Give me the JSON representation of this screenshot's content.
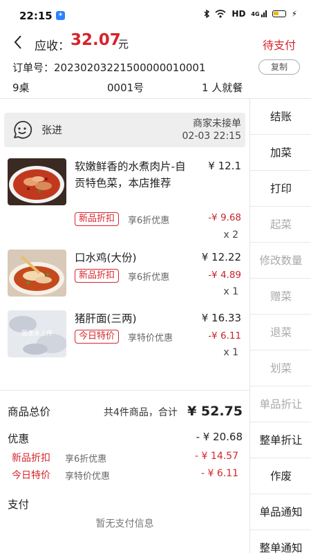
{
  "status_bar": {
    "time": "22:15",
    "app_badge": "✶",
    "network": "HD",
    "signal": "4G"
  },
  "header": {
    "amount_label": "应收：",
    "amount_value": "32.07",
    "amount_unit": "元",
    "status": "待支付",
    "order_no": "订单号：20230203221500000010001",
    "copy_label": "复制",
    "table": "9桌",
    "serial": "0001号",
    "diners": "1 人就餐"
  },
  "customer": {
    "name": "张进",
    "status": "商家未接单",
    "time": "02-03 22:15"
  },
  "dishes": [
    {
      "name": "软嫩鲜香的水煮肉片-自贡特色菜，本店推荐",
      "price": "¥ 12.1",
      "tag": "新品折扣",
      "tag_desc": "享6折优惠",
      "discount": "-¥ 9.68",
      "qty": "x 2",
      "image": "boiled-pork-slices"
    },
    {
      "name": "口水鸡(大份)",
      "price": "¥ 12.22",
      "tag": "新品折扣",
      "tag_desc": "享6折优惠",
      "discount": "-¥ 4.89",
      "qty": "x 1",
      "image": "mouthwatering-chicken"
    },
    {
      "name": "猪肝面(三两)",
      "price": "¥ 16.33",
      "tag": "今日特价",
      "tag_desc": "享特价优惠",
      "discount": "-¥ 6.11",
      "qty": "x 1",
      "image": "placeholder",
      "image_text": "图像未上传"
    }
  ],
  "summary": {
    "total_label": "商品总价",
    "count_text": "共4件商品，合计",
    "total": "¥ 52.75",
    "discount_label": "优惠",
    "discount_total": "- ¥ 20.68",
    "discounts": [
      {
        "name": "新品折扣",
        "desc": "享6折优惠",
        "amount": "- ¥ 14.57"
      },
      {
        "name": "今日特价",
        "desc": "享特价优惠",
        "amount": "- ¥ 6.11"
      }
    ],
    "payment_label": "支付",
    "no_payment": "暂无支付信息"
  },
  "sidebar": {
    "items": [
      {
        "label": "结账",
        "enabled": true
      },
      {
        "label": "加菜",
        "enabled": true
      },
      {
        "label": "打印",
        "enabled": true
      },
      {
        "label": "起菜",
        "enabled": false
      },
      {
        "label": "修改数量",
        "enabled": false
      },
      {
        "label": "赠菜",
        "enabled": false
      },
      {
        "label": "退菜",
        "enabled": false
      },
      {
        "label": "划菜",
        "enabled": false
      },
      {
        "label": "单品折让",
        "enabled": false
      },
      {
        "label": "整单折让",
        "enabled": true
      },
      {
        "label": "作废",
        "enabled": true
      },
      {
        "label": "单品通知",
        "enabled": true
      },
      {
        "label": "整单通知",
        "enabled": true
      }
    ]
  },
  "colors": {
    "accent": "#d6242b",
    "panel": "#eeeeee",
    "disabled": "#aaaaaa"
  }
}
